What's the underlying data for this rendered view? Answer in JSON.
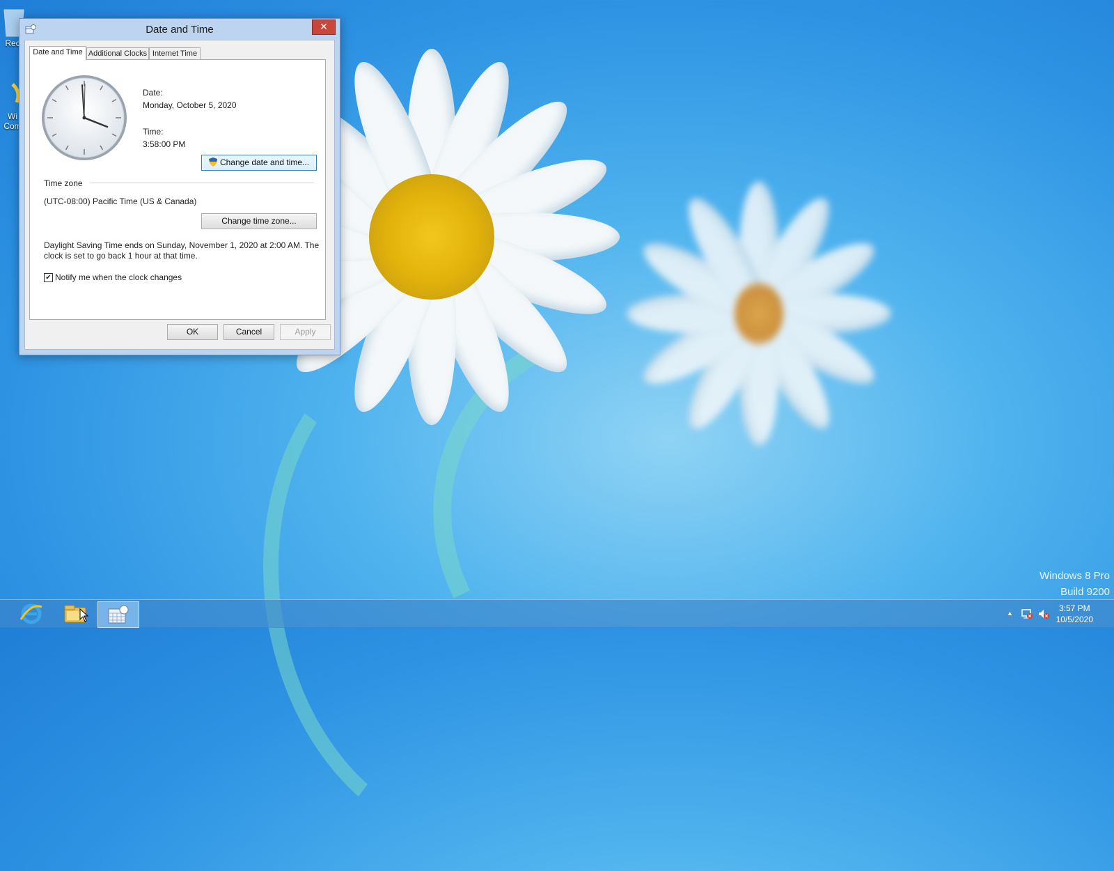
{
  "desktop": {
    "icons": [
      {
        "label": "Rec"
      },
      {
        "label": "Wi"
      },
      {
        "label": "Com"
      }
    ],
    "watermark": {
      "line1": "Windows 8 Pro",
      "line2": "Build 9200"
    }
  },
  "dialog": {
    "title": "Date and Time",
    "close_label": "✕",
    "tabs": [
      {
        "label": "Date and Time",
        "active": true
      },
      {
        "label": "Additional Clocks",
        "active": false
      },
      {
        "label": "Internet Time",
        "active": false
      }
    ],
    "date_label": "Date:",
    "date_value": "Monday, October 5, 2020",
    "time_label": "Time:",
    "time_value": "3:58:00 PM",
    "change_datetime_button": "Change date and time...",
    "timezone_header": "Time zone",
    "timezone_value": "(UTC-08:00) Pacific Time (US & Canada)",
    "change_timezone_button": "Change time zone...",
    "dst_line1": "Daylight Saving Time ends on Sunday, November 1, 2020 at 2:00 AM. The",
    "dst_line2": "clock is set to go back 1 hour at that time.",
    "notify_checkbox_checked": true,
    "notify_label": "Notify me when the clock changes",
    "ok_button": "OK",
    "cancel_button": "Cancel",
    "apply_button": "Apply"
  },
  "taskbar": {
    "items": [
      {
        "icon": "internet-explorer-icon"
      },
      {
        "icon": "file-explorer-icon"
      },
      {
        "icon": "date-time-icon",
        "active": true
      }
    ],
    "tray_icons": [
      "show-hidden-icons-chevron",
      "network-error-icon",
      "volume-muted-icon"
    ],
    "tray_chevron": "▲",
    "clock_time": "3:57 PM",
    "clock_date": "10/5/2020"
  },
  "colors": {
    "accent": "#2e93e3",
    "close_button": "#c8463a",
    "dialog_frame": "#bcd4ef"
  }
}
